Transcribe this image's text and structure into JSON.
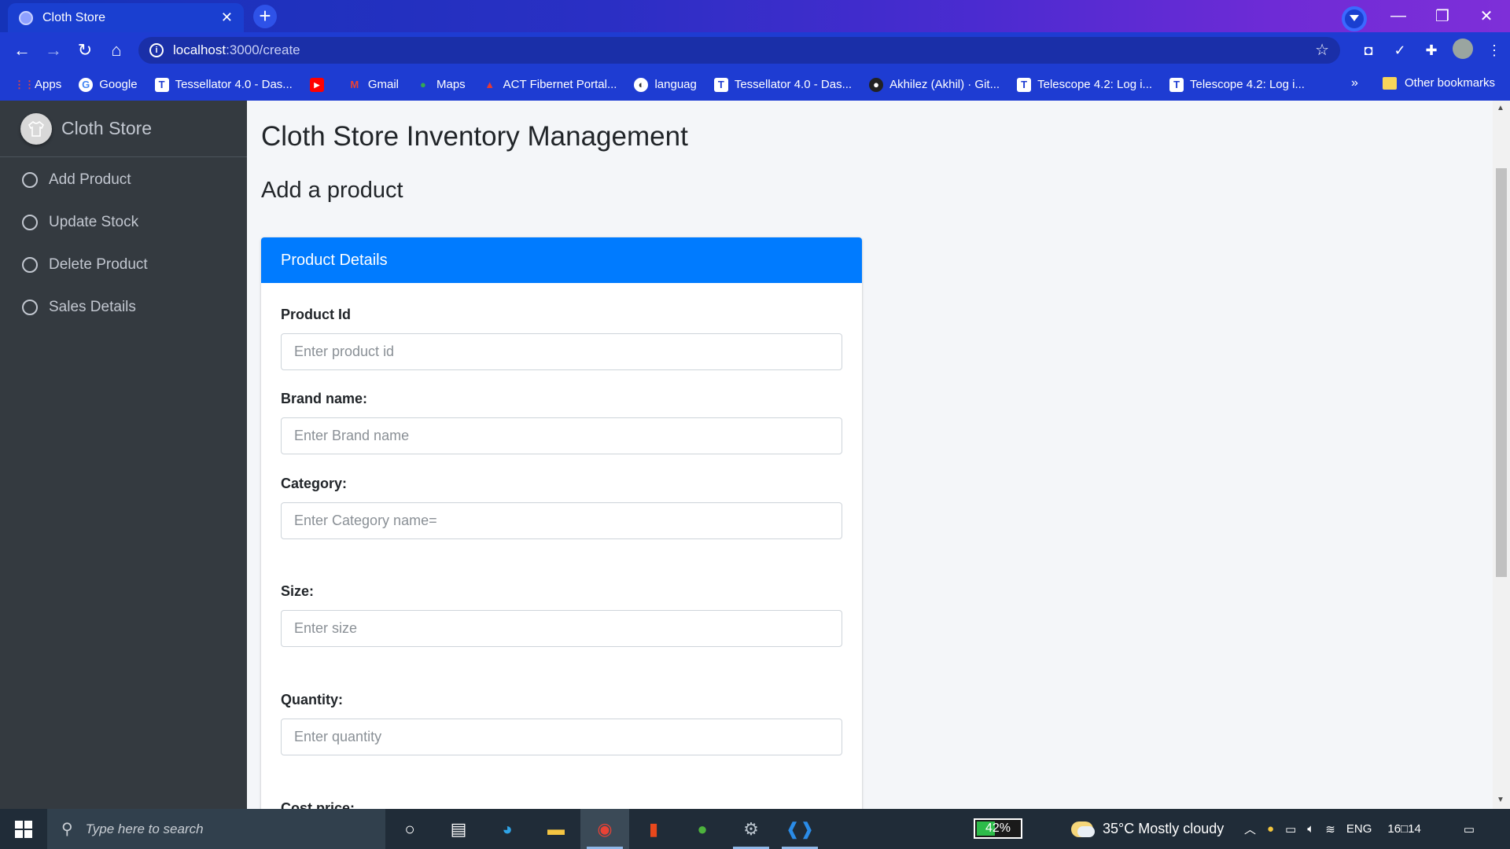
{
  "browser": {
    "tab_title": "Cloth Store",
    "tab_close": "✕",
    "new_tab": "+",
    "url_host": "localhost",
    "url_path": ":3000/create",
    "window_controls": [
      "—",
      "❐",
      "✕"
    ],
    "bookmarks": [
      {
        "label": "Apps",
        "icon": "apps-grid-icon"
      },
      {
        "label": "Google",
        "icon": "google-icon"
      },
      {
        "label": "Tessellator 4.0 - Das...",
        "icon": "tu-icon"
      },
      {
        "label": "",
        "icon": "youtube-icon"
      },
      {
        "label": "Gmail",
        "icon": "gmail-icon"
      },
      {
        "label": "Maps",
        "icon": "maps-icon"
      },
      {
        "label": "ACT Fibernet Portal...",
        "icon": "act-icon"
      },
      {
        "label": "languag",
        "icon": "globe-icon"
      },
      {
        "label": "Tessellator 4.0 - Das...",
        "icon": "tu-icon"
      },
      {
        "label": "Akhilez (Akhil) · Git...",
        "icon": "github-icon"
      },
      {
        "label": "Telescope 4.2: Log i...",
        "icon": "tu-icon"
      },
      {
        "label": "Telescope 4.2: Log i...",
        "icon": "tu-icon"
      }
    ],
    "bookmarks_more": "»",
    "other_bookmarks": "Other bookmarks"
  },
  "sidebar": {
    "brand": "Cloth Store",
    "items": [
      {
        "label": "Add Product"
      },
      {
        "label": "Update Stock"
      },
      {
        "label": "Delete Product"
      },
      {
        "label": "Sales Details"
      }
    ]
  },
  "main": {
    "title": "Cloth Store Inventory Management",
    "subtitle": "Add a product",
    "card_header": "Product Details",
    "fields": [
      {
        "label": "Product Id",
        "placeholder": "Enter product id"
      },
      {
        "label": "Brand name:",
        "placeholder": "Enter Brand name"
      },
      {
        "label": "Category:",
        "placeholder": "Enter Category name="
      },
      {
        "label": "Size:",
        "placeholder": "Enter size"
      },
      {
        "label": "Quantity:",
        "placeholder": "Enter quantity"
      },
      {
        "label": "Cost price:",
        "placeholder": ""
      }
    ]
  },
  "taskbar": {
    "search_placeholder": "Type here to search",
    "battery": "42%",
    "battery_level": 0.42,
    "weather": "35°C  Mostly cloudy",
    "language": "ENG",
    "time": "16□14"
  },
  "colors": {
    "accent": "#007bff",
    "sidebar_bg": "#343a40",
    "browser_frame": "#1e3cd2"
  }
}
